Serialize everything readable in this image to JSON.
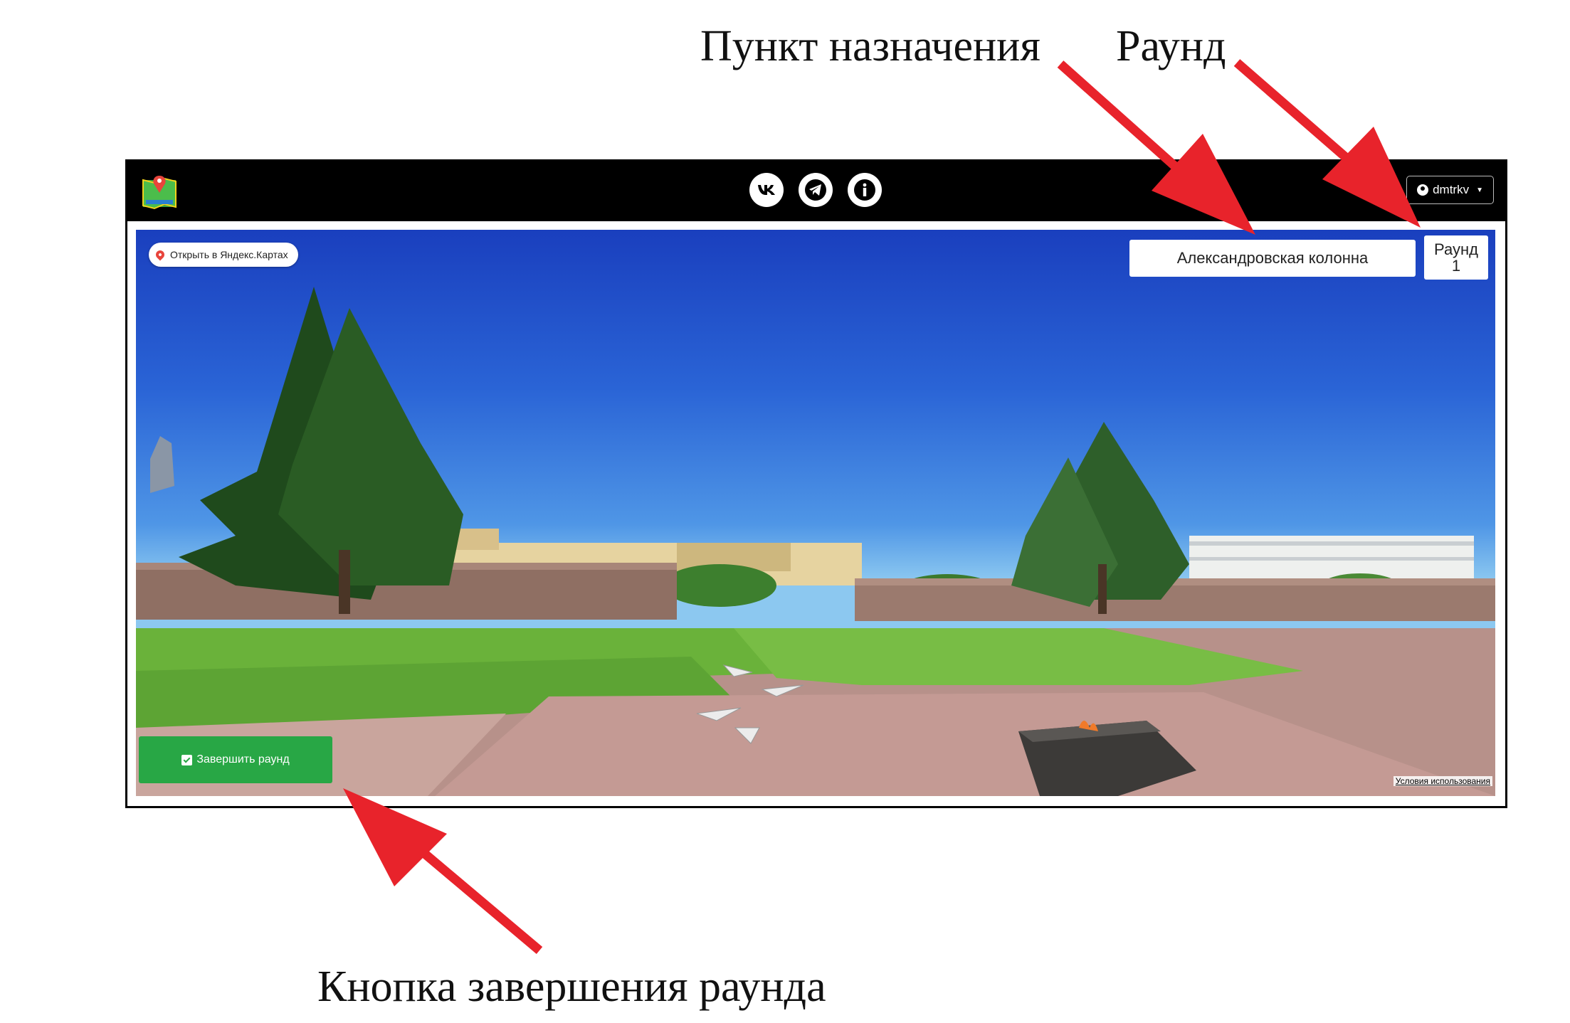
{
  "annotations": {
    "destination": "Пункт назначения",
    "round": "Раунд",
    "finish_button": "Кнопка завершения раунда"
  },
  "navbar": {
    "social_icons": [
      "vk-icon",
      "telegram-icon",
      "info-icon"
    ],
    "user": {
      "name": "dmtrkv",
      "icon": "user-circle-icon"
    }
  },
  "panorama": {
    "yandex_link": "Открыть в Яндекс.Картах",
    "destination": "Александровская колонна",
    "round_label": "Раунд",
    "round_number": "1",
    "finish_button": "Завершить раунд",
    "terms": "Условия использования"
  },
  "colors": {
    "accent_green": "#28a745",
    "arrow_red": "#e8232b",
    "navbar_black": "#000000"
  }
}
